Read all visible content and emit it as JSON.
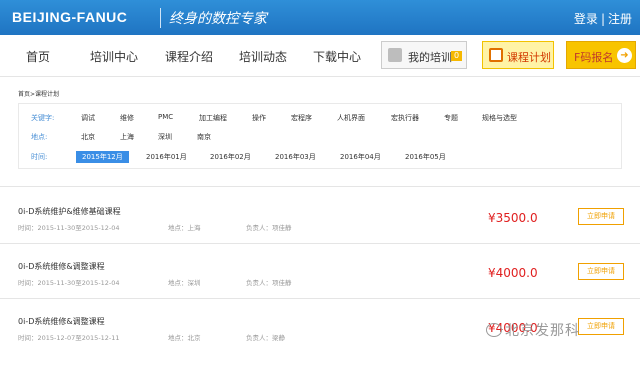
{
  "header": {
    "logo": "BEIJING-FANUC",
    "slogan": "终身的数控专家",
    "login": "登录",
    "separator": "|",
    "register": "注册"
  },
  "nav": {
    "items": [
      {
        "label": "首页"
      },
      {
        "label": "培训中心"
      },
      {
        "label": "课程介绍"
      },
      {
        "label": "培训动态"
      },
      {
        "label": "下载中心"
      }
    ],
    "my_training_label": "我的培训",
    "my_training_count": "0",
    "course_plan_label": "课程计划",
    "enroll_label": "F码报名"
  },
  "breadcrumb": "首页>课程计划",
  "filters": {
    "keyword_label": "关键字:",
    "keywords": [
      "调试",
      "维修",
      "PMC",
      "加工编程",
      "操作",
      "宏程序",
      "人机界面",
      "宏执行器",
      "专题",
      "规格与选型"
    ],
    "location_label": "地点:",
    "locations": [
      "北京",
      "上海",
      "深圳",
      "南京"
    ],
    "time_label": "时间:",
    "times": [
      "2015年12月",
      "2016年01月",
      "2016年02月",
      "2016年03月",
      "2016年04月",
      "2016年05月"
    ],
    "selected_time": "2015年12月"
  },
  "courses": [
    {
      "title": "0i-D系统维护&维修基础课程",
      "time": "时间：2015-11-30至2015-12-04",
      "location": "地点：上海",
      "owner": "负责人：项佳静",
      "price": "¥3500.0",
      "apply": "立即申请"
    },
    {
      "title": "0i-D系统维修&调整课程",
      "time": "时间：2015-11-30至2015-12-04",
      "location": "地点：深圳",
      "owner": "负责人：项佳静",
      "price": "¥4000.0",
      "apply": "立即申请"
    },
    {
      "title": "0i-D系统维修&调整课程",
      "time": "时间：2015-12-07至2015-12-11",
      "location": "地点：北京",
      "owner": "负责人：梁静",
      "price": "¥4000.0",
      "apply": "立即申请"
    }
  ],
  "watermark": "北京发那科",
  "colors": {
    "header_blue": "#1f74c2",
    "price_red": "#e02020",
    "accent_orange": "#f0a000",
    "enroll_yellow": "#f8c400",
    "selected_blue": "#3a8ee6"
  }
}
